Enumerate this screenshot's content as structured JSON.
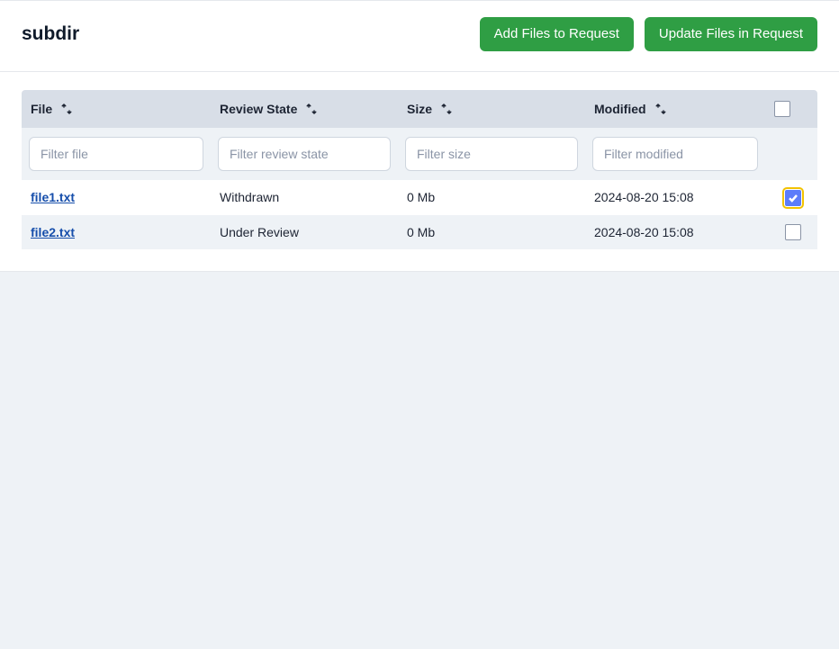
{
  "header": {
    "title": "subdir",
    "add_button": "Add Files to Request",
    "update_button": "Update Files in Request"
  },
  "table": {
    "columns": {
      "file": "File",
      "review_state": "Review State",
      "size": "Size",
      "modified": "Modified"
    },
    "filters": {
      "file_placeholder": "Filter file",
      "review_state_placeholder": "Filter review state",
      "size_placeholder": "Filter size",
      "modified_placeholder": "Filter modified"
    },
    "rows": [
      {
        "file": "file1.txt",
        "review_state": "Withdrawn",
        "size": "0 Mb",
        "modified": "2024-08-20 15:08",
        "checked": true,
        "focused": true
      },
      {
        "file": "file2.txt",
        "review_state": "Under Review",
        "size": "0 Mb",
        "modified": "2024-08-20 15:08",
        "checked": false,
        "focused": false
      }
    ],
    "select_all_checked": false
  }
}
